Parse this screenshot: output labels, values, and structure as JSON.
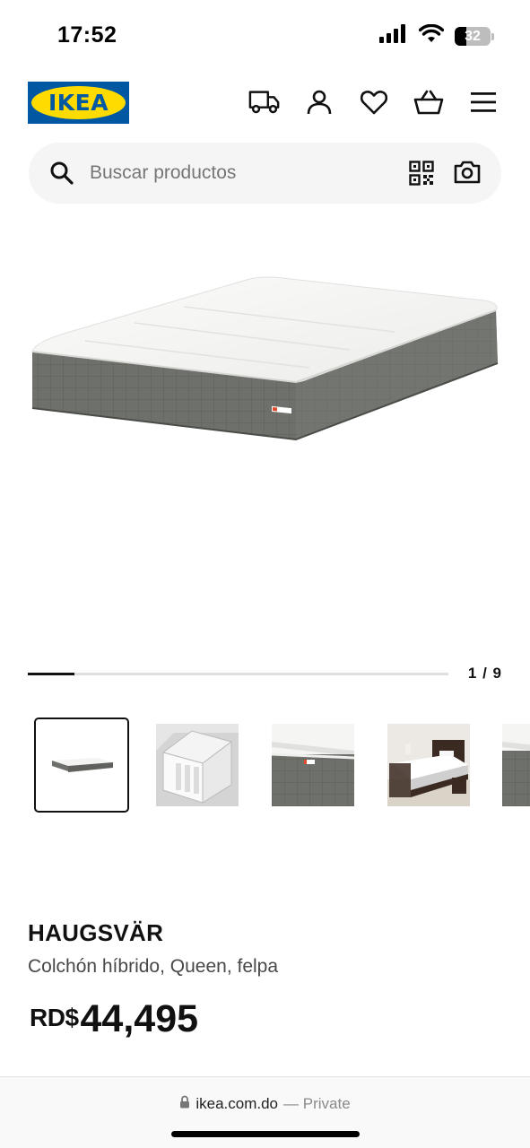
{
  "status_bar": {
    "time": "17:52",
    "battery_level": "32",
    "icons": [
      "cellular-signal-icon",
      "wifi-icon",
      "battery-icon"
    ]
  },
  "header": {
    "logo_text": "IKEA",
    "icons": [
      "delivery-truck-icon",
      "profile-icon",
      "wishlist-heart-icon",
      "shopping-basket-icon",
      "menu-hamburger-icon"
    ]
  },
  "search": {
    "placeholder": "Buscar productos",
    "value": "",
    "icons": [
      "search-icon",
      "qr-code-icon",
      "camera-icon"
    ]
  },
  "gallery": {
    "current_page": "1 / 9",
    "progress_fraction": 0.111,
    "thumbnails": [
      "mattress-overview",
      "mattress-cutaway",
      "mattress-detail",
      "mattress-in-bedroom",
      "mattress-partial"
    ],
    "selected_index": 0
  },
  "product": {
    "name": "HAUGSVÄR",
    "description": "Colchón híbrido, Queen, felpa",
    "price_currency": "RD$",
    "price_value": "44,495"
  },
  "browser": {
    "url": "ikea.com.do",
    "mode": "— Private",
    "icons": [
      "lock-icon"
    ]
  },
  "colors": {
    "ikea_blue": "#0058a3",
    "ikea_yellow": "#ffdb00",
    "mattress_top": "#f4f4f2",
    "mattress_side": "#6e706b"
  }
}
